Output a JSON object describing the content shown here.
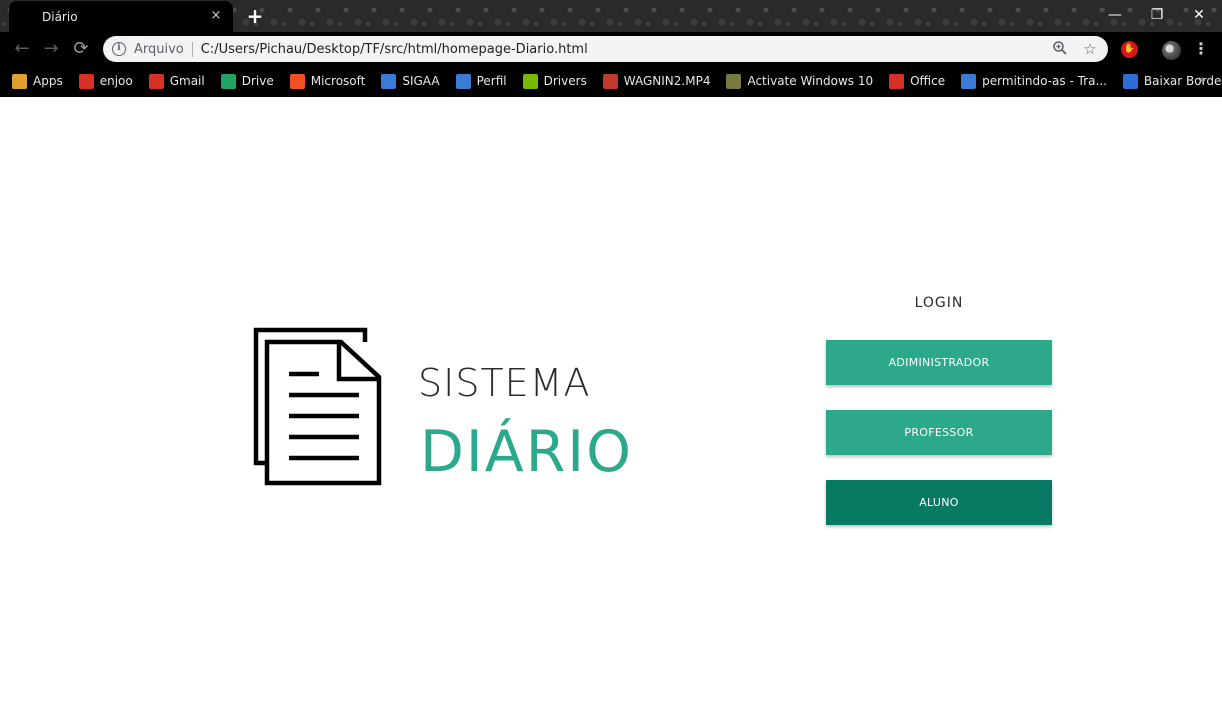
{
  "browser": {
    "tab_title": "Diário",
    "tab_close": "×",
    "new_tab": "+",
    "scheme_label": "Arquivo",
    "url": "C:/Users/Pichau/Desktop/TF/src/html/homepage-Diario.html",
    "window_controls": {
      "minimize": "—",
      "restore": "❐",
      "close": "✕"
    },
    "bookmarks": [
      {
        "label": "Apps",
        "icon": "apps-grid-icon",
        "color": "#e0a030"
      },
      {
        "label": "enjoo",
        "icon": "enjoo-icon",
        "color": "#d93025"
      },
      {
        "label": "Gmail",
        "icon": "gmail-icon",
        "color": "#d93025"
      },
      {
        "label": "Drive",
        "icon": "drive-icon",
        "color": "#1fa463"
      },
      {
        "label": "Microsoft",
        "icon": "microsoft-icon",
        "color": "#f25022"
      },
      {
        "label": "SIGAA",
        "icon": "sigaa-icon",
        "color": "#3a7bd5"
      },
      {
        "label": "Perfil",
        "icon": "perfil-icon",
        "color": "#3a7bd5"
      },
      {
        "label": "Drivers",
        "icon": "nvidia-icon",
        "color": "#76b900"
      },
      {
        "label": "WAGNIN2.MP4",
        "icon": "video-icon",
        "color": "#c0392b"
      },
      {
        "label": "Activate Windows 10",
        "icon": "windows-icon",
        "color": "#7a7a40"
      },
      {
        "label": "Office",
        "icon": "office-icon",
        "color": "#d93025"
      },
      {
        "label": "permitindo-as - Tra...",
        "icon": "linguee-icon",
        "color": "#3a7bd5"
      },
      {
        "label": "Baixar Borderlands...",
        "icon": "download-icon",
        "color": "#2b6ed6"
      }
    ],
    "bookmarks_more": "»"
  },
  "page": {
    "brand_top": "SISTEMA",
    "brand_bottom": "DIÁRIO",
    "login_title": "LOGIN",
    "buttons": {
      "admin": "ADIMINISTRADOR",
      "professor": "PROFESSOR",
      "aluno": "ALUNO"
    }
  },
  "colors": {
    "accent": "#2ca88a",
    "accent_dark": "#087a63"
  }
}
